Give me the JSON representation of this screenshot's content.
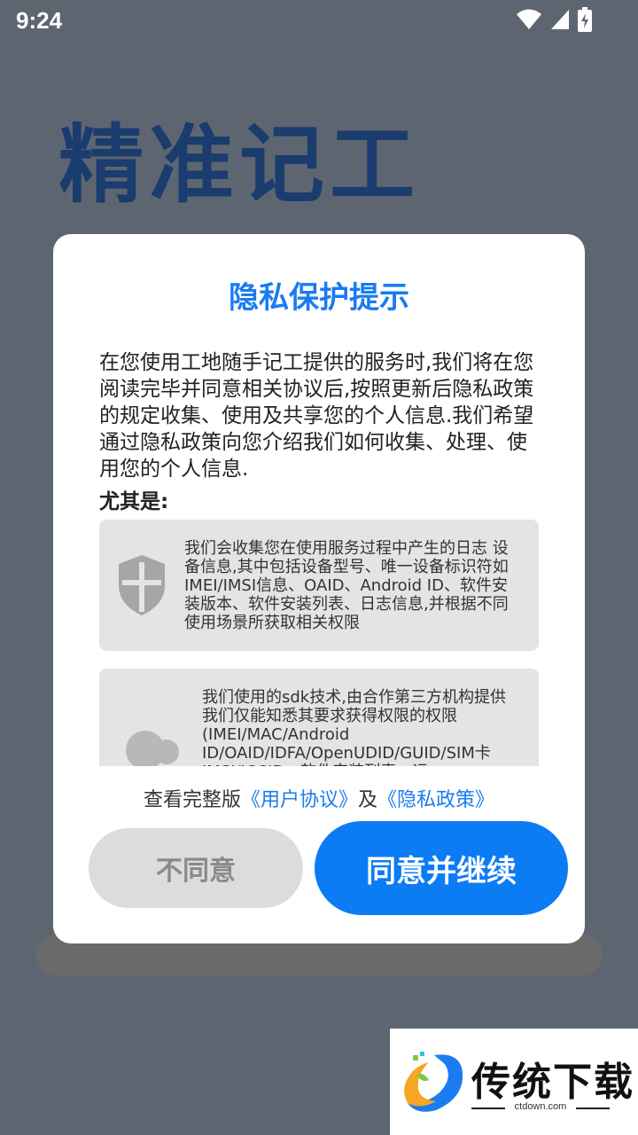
{
  "status_bar": {
    "time": "9:24"
  },
  "brand": {
    "title": "精准记工"
  },
  "dialog": {
    "title": "隐私保护提示",
    "intro": "在您使用工地随手记工提供的服务时,我们将在您阅读完毕并同意相关协议后,按照更新后隐私政策的规定收集、使用及共享您的个人信息.我们希望通过隐私政策向您介绍我们如何收集、处理、使用您的个人信息.",
    "especially_label": "尤其是:",
    "cards": [
      {
        "icon": "shield-icon",
        "text": "我们会收集您在使用服务过程中产生的日志 设备信息,其中包括设备型号、唯一设备标识符如IMEI/IMSI信息、OAID、Android ID、软件安装版本、软件安装列表、日志信息,并根据不同使用场景所获取相关权限"
      },
      {
        "icon": "people-icon",
        "text": "我们使用的sdk技术,由合作第三方机构提供我们仅能知悉其要求获得权限的权限(IMEI/MAC/Android ID/OAID/IDFA/OpenUDID/GUID/SIM卡IMSI/ICCID、软件安装列表、运"
      }
    ],
    "links": {
      "prefix": "查看完整版",
      "user_agreement": "《用户协议》",
      "and": "及",
      "privacy_policy": "《隐私政策》"
    },
    "buttons": {
      "disagree": "不同意",
      "agree": "同意并继续"
    }
  },
  "watermark": {
    "text": "传统下载",
    "url": "ctdown.com"
  },
  "colors": {
    "accent": "#0c7cf5",
    "brand_dark": "#1a3c6e",
    "overlay": "#5d6670"
  }
}
